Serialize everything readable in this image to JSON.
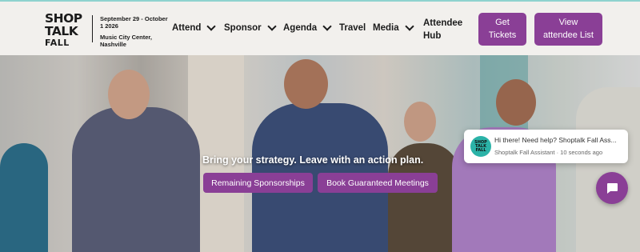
{
  "logo": {
    "line1": "SHOP",
    "line2": "TALK",
    "line3": "FALL"
  },
  "event": {
    "dates": "September 29 - October 1 2026",
    "venue": "Music City Center, Nashville"
  },
  "nav": {
    "attend": "Attend",
    "sponsor": "Sponsor",
    "agenda": "Agenda",
    "travel": "Travel",
    "media": "Media",
    "attendee_hub": "Attendee Hub"
  },
  "header_buttons": {
    "tickets": "Get Tickets",
    "attendee_list": "View attendee List"
  },
  "hero": {
    "tagline": "Bring your strategy. Leave with an action plan.",
    "remaining_sponsorships": "Remaining Sponsorships",
    "book_meetings": "Book Guaranteed Meetings"
  },
  "chat": {
    "avatar_line1": "SHOP",
    "avatar_line2": "TALK",
    "avatar_line3": "FALL",
    "message": "Hi there! Need help? Shoptalk Fall Ass...",
    "sender": "Shoptalk Fall Assistant",
    "time": "10 seconds ago",
    "bubble_icon": "chat-icon"
  },
  "colors": {
    "accent": "#8a3f96",
    "header_bg": "#f2f0ed",
    "top_border": "#8fd3cf"
  }
}
